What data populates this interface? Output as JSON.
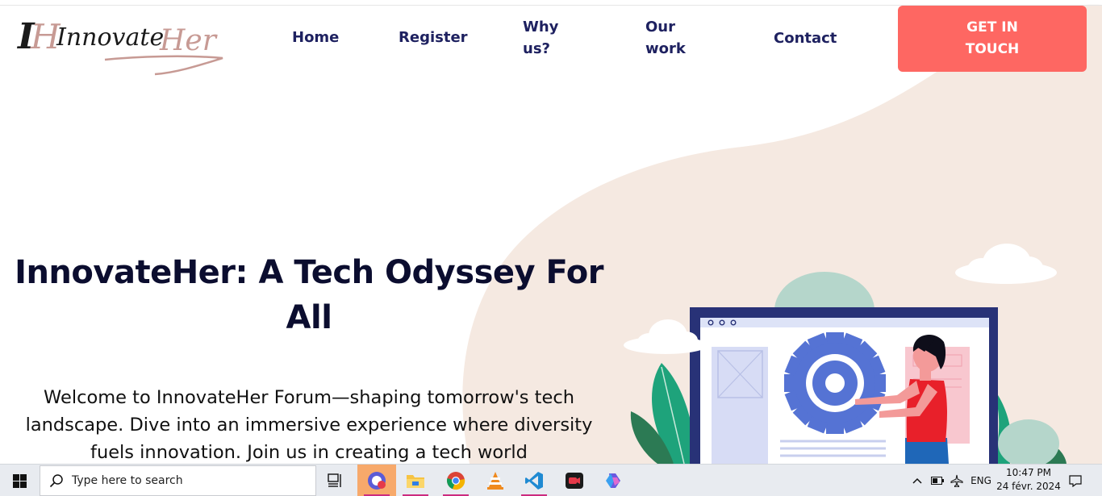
{
  "brand": {
    "logo_text": "InnovateHer",
    "logo_monogram": "IH"
  },
  "nav": {
    "items": [
      {
        "label": "Home"
      },
      {
        "label": "Register"
      },
      {
        "label": "Why us?"
      },
      {
        "label": "Our work"
      },
      {
        "label": "Contact"
      }
    ],
    "cta_label": "GET IN TOUCH"
  },
  "hero": {
    "title": "InnovateHer: A Tech Odyssey For All",
    "text": "Welcome to InnovateHer Forum—shaping tomorrow's tech landscape. Dive into an immersive experience where diversity fuels innovation. Join us in creating a tech world"
  },
  "colors": {
    "accent": "#fe6762",
    "nav_text": "#1e2160",
    "title_text": "#0b0d2f",
    "wave_bg": "#f5e9e1",
    "illus_blue": "#5573d4",
    "illus_frame": "#283277"
  },
  "taskbar": {
    "search_placeholder": "Type here to search",
    "apps": [
      {
        "name": "gamebar-icon"
      },
      {
        "name": "file-explorer-icon"
      },
      {
        "name": "chrome-icon"
      },
      {
        "name": "vlc-icon"
      },
      {
        "name": "vscode-icon"
      },
      {
        "name": "screen-recorder-icon"
      },
      {
        "name": "copilot-icon"
      }
    ],
    "language": "ENG",
    "time": "10:47 PM",
    "date": "24 févr. 2024"
  }
}
